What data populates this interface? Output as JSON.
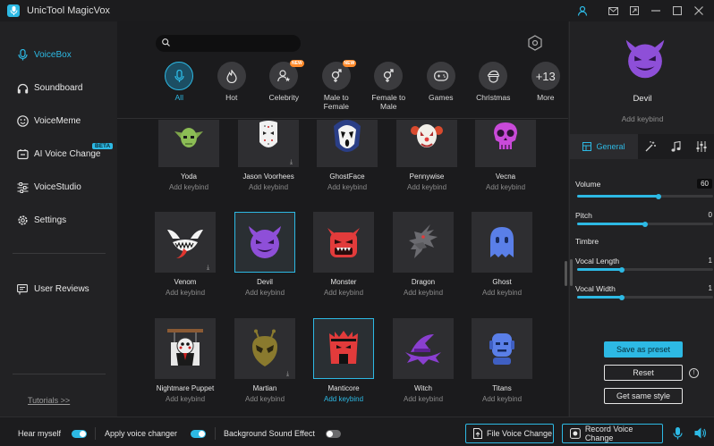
{
  "app": {
    "title": "UnicTool MagicVox"
  },
  "titlebar": {
    "icons": [
      "user-icon",
      "mail-icon",
      "external-link-icon",
      "minimize-icon",
      "maximize-icon",
      "close-icon"
    ]
  },
  "sidebar": {
    "items": [
      {
        "label": "VoiceBox",
        "icon": "microphone-icon",
        "active": true
      },
      {
        "label": "Soundboard",
        "icon": "headphones-icon"
      },
      {
        "label": "VoiceMeme",
        "icon": "smile-icon"
      },
      {
        "label": "AI Voice Change",
        "icon": "ai-voice-icon",
        "badge": "BETA"
      },
      {
        "label": "VoiceStudio",
        "icon": "sliders-icon"
      },
      {
        "label": "Settings",
        "icon": "gear-icon"
      },
      {
        "label": "User Reviews",
        "icon": "message-icon"
      }
    ],
    "tutorial": "Tutorials >>"
  },
  "search": {
    "placeholder": ""
  },
  "categories": [
    {
      "label": "All",
      "icon": "microphone-icon",
      "active": true
    },
    {
      "label": "Hot",
      "icon": "flame-icon"
    },
    {
      "label": "Celebrity",
      "icon": "star-person-icon",
      "badge": "NEW"
    },
    {
      "label": "Male to Female",
      "icon": "gender-mf-icon",
      "badge": "NEW"
    },
    {
      "label": "Female to Male",
      "icon": "gender-fm-icon"
    },
    {
      "label": "Games",
      "icon": "gamepad-icon"
    },
    {
      "label": "Christmas",
      "icon": "santa-icon"
    },
    {
      "label": "+13",
      "sub": "More"
    }
  ],
  "voices": [
    {
      "name": "Yoda",
      "keybind": "Add keybind",
      "icon": "yoda-icon"
    },
    {
      "name": "Jason Voorhees",
      "keybind": "Add keybind",
      "icon": "hockey-mask-icon"
    },
    {
      "name": "GhostFace",
      "keybind": "Add keybind",
      "icon": "ghostface-icon"
    },
    {
      "name": "Pennywise",
      "keybind": "Add keybind",
      "icon": "clown-icon"
    },
    {
      "name": "Vecna",
      "keybind": "Add keybind",
      "icon": "skull-icon"
    },
    {
      "name": "Venom",
      "keybind": "Add keybind",
      "icon": "venom-icon"
    },
    {
      "name": "Devil",
      "keybind": "Add keybind",
      "icon": "devil-icon",
      "selected": true
    },
    {
      "name": "Monster",
      "keybind": "Add keybind",
      "icon": "monster-icon"
    },
    {
      "name": "Dragon",
      "keybind": "Add keybind",
      "icon": "dragon-icon"
    },
    {
      "name": "Ghost",
      "keybind": "Add keybind",
      "icon": "ghost-icon"
    },
    {
      "name": "Nightmare Puppet",
      "keybind": "Add keybind",
      "icon": "puppet-icon"
    },
    {
      "name": "Martian",
      "keybind": "Add keybind",
      "icon": "alien-icon"
    },
    {
      "name": "Manticore",
      "keybind": "Add keybind",
      "icon": "manticore-icon",
      "highlight": true
    },
    {
      "name": "Witch",
      "keybind": "Add keybind",
      "icon": "witch-hat-icon"
    },
    {
      "name": "Titans",
      "keybind": "Add keybind",
      "icon": "titan-icon"
    }
  ],
  "panel": {
    "voice_name": "Devil",
    "keybind": "Add keybind",
    "tabs": {
      "general": "General"
    },
    "volume": {
      "label": "Volume",
      "value": "60",
      "level": 0.6
    },
    "pitch": {
      "label": "Pitch",
      "value": "0",
      "level": 0.5
    },
    "timbre": {
      "label": "Timbre"
    },
    "vocal_length": {
      "label": "Vocal Length",
      "value": "1",
      "level": 0.33
    },
    "vocal_width": {
      "label": "Vocal Width",
      "value": "1",
      "level": 0.33
    },
    "save_preset": "Save as preset",
    "reset": "Reset",
    "get_same_style": "Get same style",
    "info": "!"
  },
  "bottom": {
    "hear_myself": "Hear myself",
    "hear_myself_on": true,
    "apply_voice_changer": "Apply voice changer",
    "apply_on": true,
    "background_sound": "Background Sound Effect",
    "background_on": false,
    "file_voice_change": "File Voice Change",
    "record_voice_change": "Record Voice Change"
  },
  "colors": {
    "accent": "#2db9e4",
    "devil_purple": "#8e4fd8"
  }
}
